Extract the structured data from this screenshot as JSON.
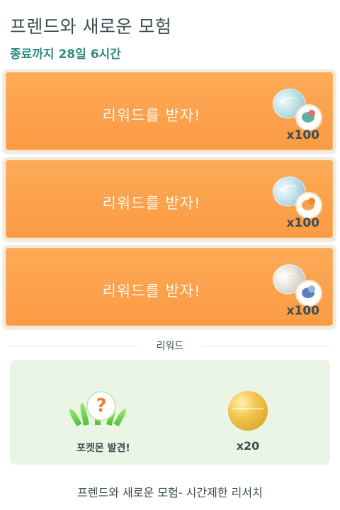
{
  "header": {
    "title": "프렌드와 새로운 모험",
    "countdown": "종료까지 28일 6시간"
  },
  "tasks": [
    {
      "label": "리워드를 받자!",
      "quantity": "x100",
      "item_icon": "stone-icon",
      "pokemon_icon": "venusaur-icon"
    },
    {
      "label": "리워드를 받자!",
      "quantity": "x100",
      "item_icon": "stone-icon",
      "pokemon_icon": "dragonite-icon"
    },
    {
      "label": "리워드를 받자!",
      "quantity": "x100",
      "item_icon": "stone-icon",
      "pokemon_icon": "blastoise-icon"
    }
  ],
  "rewards": {
    "section_title": "리워드",
    "encounter_label": "포켓몬 발견!",
    "encounter_icon": "question-mark-icon",
    "stardust_qty": "x20",
    "stardust_icon": "stardust-icon"
  },
  "footer": {
    "text": "프렌드와 새로운 모험- 시간제한 리서치"
  },
  "colors": {
    "accent_orange": "#fb9a44",
    "teal": "#2e8b7e",
    "text_dark": "#3d4f52",
    "reward_panel": "#eaf5e5"
  }
}
